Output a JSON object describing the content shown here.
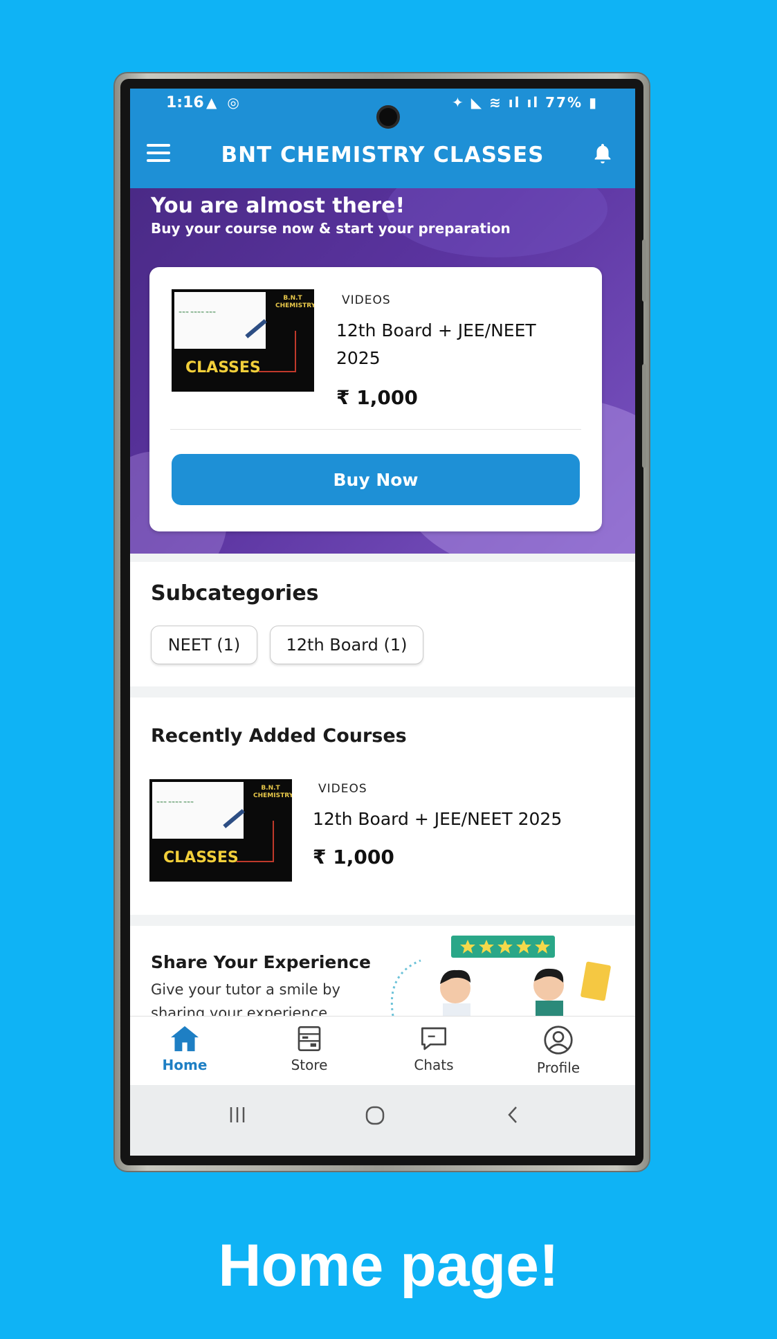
{
  "status_bar": {
    "time": "1:16",
    "left_icons": "▲ ◎",
    "right_icons": "✦ ◣ ≋ ıl ıl",
    "battery": "77%"
  },
  "app_bar": {
    "title": "BNT CHEMISTRY CLASSES",
    "menu_icon": "hamburger-menu-icon",
    "notification_icon": "bell-icon"
  },
  "promo": {
    "title": "You are almost there!",
    "subtitle": "Buy your course now & start your preparation",
    "card": {
      "thumbnail_text": "CLASSES",
      "thumbnail_brand": "B.N.T CHEMISTRY",
      "category": "VIDEOS",
      "title_line1": "12th Board + JEE/NEET",
      "title_line2": "2025",
      "price": "₹ 1,000",
      "button_label": "Buy Now"
    }
  },
  "subcategories": {
    "heading": "Subcategories",
    "chips": [
      "NEET (1)",
      "12th Board (1)"
    ]
  },
  "recent_courses": {
    "heading": "Recently Added Courses",
    "items": [
      {
        "thumbnail_text": "CLASSES",
        "thumbnail_brand": "B.N.T CHEMISTRY",
        "category": "VIDEOS",
        "title": "12th Board + JEE/NEET 2025",
        "price": "₹ 1,000"
      }
    ]
  },
  "share": {
    "title": "Share Your Experience",
    "line1": "Give your tutor a smile by",
    "line2": "sharing your experience",
    "rating_stars": 5
  },
  "bottom_nav": {
    "items": [
      {
        "label": "Home",
        "icon": "home-icon",
        "active": true
      },
      {
        "label": "Store",
        "icon": "store-icon",
        "active": false
      },
      {
        "label": "Chats",
        "icon": "chat-icon",
        "active": false
      },
      {
        "label": "Profile",
        "icon": "profile-icon",
        "active": false
      }
    ]
  },
  "caption": "Home page!",
  "colors": {
    "background": "#0fb3f5",
    "primary": "#1e90d6",
    "promo_purple": "#5b34a0",
    "active_nav": "#1e7fc4"
  }
}
